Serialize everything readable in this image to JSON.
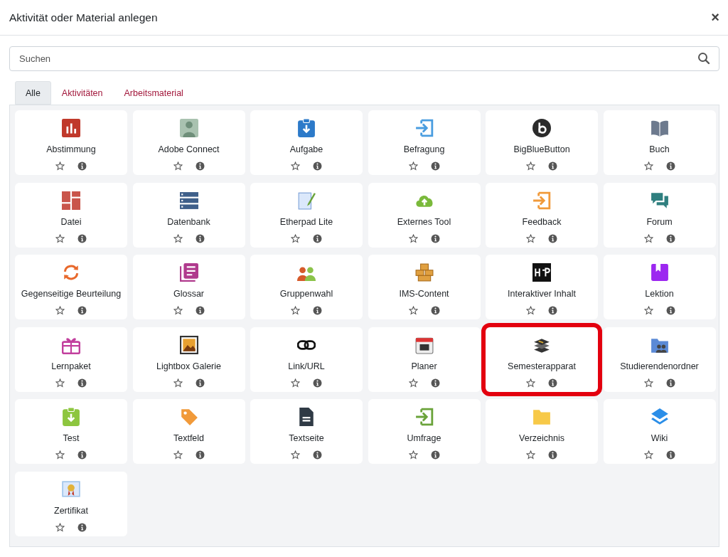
{
  "dialog": {
    "title": "Aktivität oder Material anlegen",
    "close": "×"
  },
  "search": {
    "placeholder": "Suchen"
  },
  "tabs": [
    {
      "label": "Alle",
      "selected": true
    },
    {
      "label": "Aktivitäten",
      "selected": false
    },
    {
      "label": "Arbeitsmaterial",
      "selected": false
    }
  ],
  "items": [
    {
      "name": "Abstimmung",
      "highlighted": false
    },
    {
      "name": "Adobe Connect",
      "highlighted": false
    },
    {
      "name": "Aufgabe",
      "highlighted": false
    },
    {
      "name": "Befragung",
      "highlighted": false
    },
    {
      "name": "BigBlueButton",
      "highlighted": false
    },
    {
      "name": "Buch",
      "highlighted": false
    },
    {
      "name": "Datei",
      "highlighted": false
    },
    {
      "name": "Datenbank",
      "highlighted": false
    },
    {
      "name": "Etherpad Lite",
      "highlighted": false
    },
    {
      "name": "Externes Tool",
      "highlighted": false
    },
    {
      "name": "Feedback",
      "highlighted": false
    },
    {
      "name": "Forum",
      "highlighted": false
    },
    {
      "name": "Gegenseitige Beurteilung",
      "highlighted": false
    },
    {
      "name": "Glossar",
      "highlighted": false
    },
    {
      "name": "Gruppenwahl",
      "highlighted": false
    },
    {
      "name": "IMS-Content",
      "highlighted": false
    },
    {
      "name": "Interaktiver Inhalt",
      "highlighted": false
    },
    {
      "name": "Lektion",
      "highlighted": false
    },
    {
      "name": "Lernpaket",
      "highlighted": false
    },
    {
      "name": "Lightbox Galerie",
      "highlighted": false
    },
    {
      "name": "Link/URL",
      "highlighted": false
    },
    {
      "name": "Planer",
      "highlighted": false
    },
    {
      "name": "Semesterapparat",
      "highlighted": true
    },
    {
      "name": "Studierendenordner",
      "highlighted": false
    },
    {
      "name": "Test",
      "highlighted": false
    },
    {
      "name": "Textfeld",
      "highlighted": false
    },
    {
      "name": "Textseite",
      "highlighted": false
    },
    {
      "name": "Umfrage",
      "highlighted": false
    },
    {
      "name": "Verzeichnis",
      "highlighted": false
    },
    {
      "name": "Wiki",
      "highlighted": false
    },
    {
      "name": "Zertifikat",
      "highlighted": false
    }
  ]
}
